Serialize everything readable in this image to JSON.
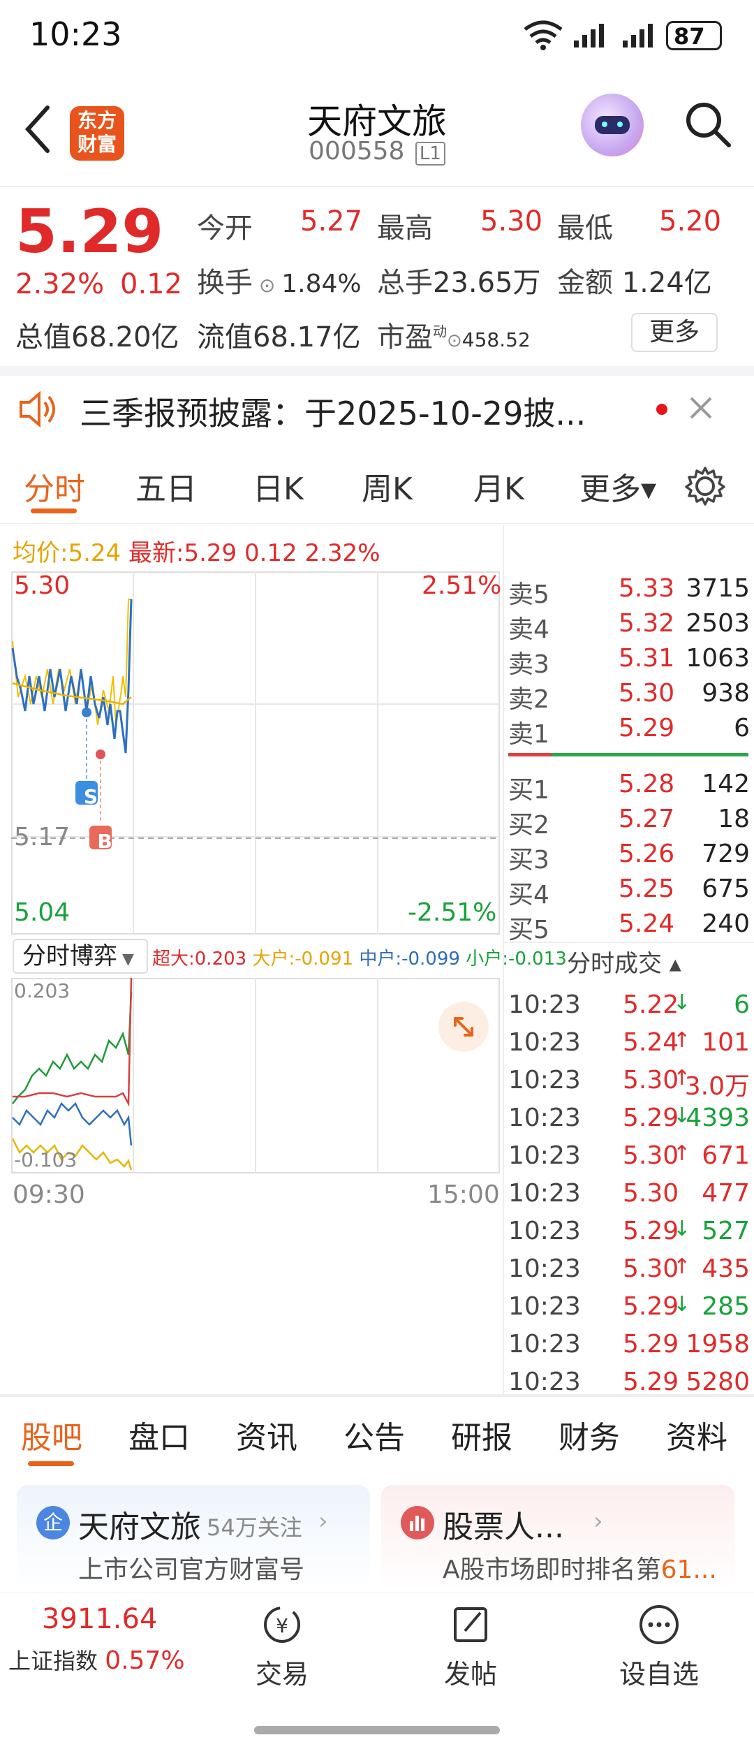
{
  "status_bar": {
    "time": "10:23",
    "battery": "87"
  },
  "header": {
    "logo_line1": "东方",
    "logo_line2": "财富",
    "stock_name": "天府文旅",
    "stock_code": "000558",
    "level_badge": "L1"
  },
  "quote": {
    "price": "5.29",
    "change_pct": "2.32%",
    "change_amt": "0.12",
    "open_label": "今开",
    "open": "5.27",
    "high_label": "最高",
    "high": "5.30",
    "low_label": "最低",
    "low": "5.20",
    "turnover_label": "换手",
    "turnover": "1.84%",
    "volume_label": "总手",
    "volume": "23.65万",
    "amount_label": "金额",
    "amount": "1.24亿",
    "total_cap_label": "总值",
    "total_cap": "68.20亿",
    "float_cap_label": "流值",
    "float_cap": "68.17亿",
    "pe_label": "市盈",
    "pe_sup": "动",
    "pe": "458.52",
    "more_button": "更多"
  },
  "notice": {
    "text": "三季报预披露：于2025-10-29披..."
  },
  "chart_tabs": [
    "分时",
    "五日",
    "日K",
    "周K",
    "月K",
    "更多▾"
  ],
  "summary": {
    "avg_label": "均价:",
    "avg": "5.24",
    "latest_label": "最新:",
    "latest": "5.29",
    "chg": "0.12",
    "pct": "2.32%"
  },
  "intraday": {
    "y_top": "5.30",
    "y_top_pct": "2.51%",
    "y_mid": "5.17",
    "y_bottom": "5.04",
    "y_bottom_pct": "-2.51%",
    "marker_s": "S",
    "marker_b": "B"
  },
  "order_book": {
    "asks": [
      {
        "label": "卖5",
        "price": "5.33",
        "vol": "3715"
      },
      {
        "label": "卖4",
        "price": "5.32",
        "vol": "2503"
      },
      {
        "label": "卖3",
        "price": "5.31",
        "vol": "1063"
      },
      {
        "label": "卖2",
        "price": "5.30",
        "vol": "938"
      },
      {
        "label": "卖1",
        "price": "5.29",
        "vol": "6"
      }
    ],
    "bids": [
      {
        "label": "买1",
        "price": "5.28",
        "vol": "142"
      },
      {
        "label": "买2",
        "price": "5.27",
        "vol": "18"
      },
      {
        "label": "买3",
        "price": "5.26",
        "vol": "729"
      },
      {
        "label": "买4",
        "price": "5.25",
        "vol": "675"
      },
      {
        "label": "买5",
        "price": "5.24",
        "vol": "240"
      }
    ]
  },
  "trades_title": "分时成交 ▴",
  "trades": [
    {
      "time": "10:23",
      "price": "5.22",
      "dir": "↓",
      "vol": "6",
      "color": "green"
    },
    {
      "time": "10:23",
      "price": "5.24",
      "dir": "↑",
      "vol": "101",
      "color": "red"
    },
    {
      "time": "10:23",
      "price": "5.30",
      "dir": "↑",
      "vol": "3.0万",
      "color": "red"
    },
    {
      "time": "10:23",
      "price": "5.29",
      "dir": "↓",
      "vol": "4393",
      "color": "green"
    },
    {
      "time": "10:23",
      "price": "5.30",
      "dir": "↑",
      "vol": "671",
      "color": "red"
    },
    {
      "time": "10:23",
      "price": "5.30",
      "dir": "",
      "vol": "477",
      "color": "red"
    },
    {
      "time": "10:23",
      "price": "5.29",
      "dir": "↓",
      "vol": "527",
      "color": "green"
    },
    {
      "time": "10:23",
      "price": "5.30",
      "dir": "↑",
      "vol": "435",
      "color": "red"
    },
    {
      "time": "10:23",
      "price": "5.29",
      "dir": "↓",
      "vol": "285",
      "color": "green"
    },
    {
      "time": "10:23",
      "price": "5.29",
      "dir": "",
      "vol": "1958",
      "color": "red"
    },
    {
      "time": "10:23",
      "price": "5.29",
      "dir": "",
      "vol": "5280",
      "color": "red"
    }
  ],
  "game": {
    "selector": "分时博弈",
    "super_label": "超大:",
    "super": "0.203",
    "large_label": "大户:",
    "large": "-0.091",
    "mid_label": "中户:",
    "mid": "-0.099",
    "small_label": "小户:",
    "small": "-0.013",
    "y_top": "0.203",
    "y_bottom": "-0.103",
    "x_start": "09:30",
    "x_end": "15:00"
  },
  "bottom_tabs": [
    "股吧",
    "盘口",
    "资讯",
    "公告",
    "研报",
    "财务",
    "资料"
  ],
  "cards": [
    {
      "title": "天府文旅",
      "sub": "54万关注",
      "desc": "上市公司官方财富号"
    },
    {
      "title": "股票人...",
      "desc_prefix": "A股市场即时排名第",
      "desc_num": "61..."
    }
  ],
  "footer": {
    "index_value": "3911.64",
    "index_name": "上证指数",
    "index_pct": "0.57%",
    "trade": "交易",
    "post": "发帖",
    "watchlist": "设自选"
  },
  "colors": {
    "accent": "#e8641b",
    "up": "#e02a2a",
    "down": "#18a23a"
  }
}
